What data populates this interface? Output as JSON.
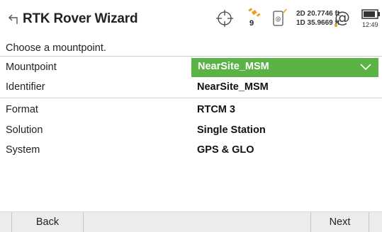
{
  "header": {
    "title": "RTK Rover Wizard",
    "satellites": "9",
    "accuracy_2d": "2D 20.7746 ft",
    "accuracy_1d": "1D 35.9669 ft",
    "time": "12:49",
    "icons": [
      "back-arrow-icon",
      "crosshair-icon",
      "satellite-icon",
      "cellular-modem-icon",
      "internet-at-icon",
      "battery-icon"
    ]
  },
  "prompt": "Choose a mountpoint.",
  "fields": {
    "mountpoint": {
      "label": "Mountpoint",
      "value": "NearSite_MSM"
    },
    "identifier": {
      "label": "Identifier",
      "value": "NearSite_MSM"
    },
    "format": {
      "label": "Format",
      "value": "RTCM 3"
    },
    "solution": {
      "label": "Solution",
      "value": "Single Station"
    },
    "system": {
      "label": "System",
      "value": "GPS & GLO"
    }
  },
  "footer": {
    "back_label": "Back",
    "next_label": "Next"
  },
  "colors": {
    "accent": "#5cb345",
    "footer_bg": "#ececec"
  }
}
